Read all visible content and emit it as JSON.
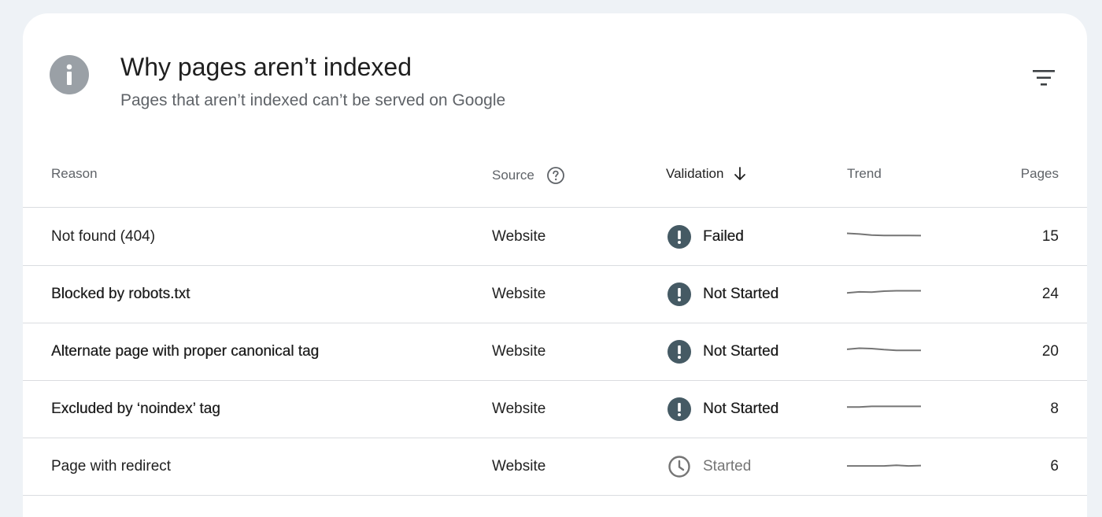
{
  "header": {
    "title": "Why pages aren’t indexed",
    "subtitle": "Pages that aren’t indexed can’t be served on Google",
    "icon": "info-icon",
    "filter_icon": "filter-icon"
  },
  "table": {
    "columns": {
      "reason": "Reason",
      "source": "Source",
      "validation": "Validation",
      "trend": "Trend",
      "pages": "Pages"
    },
    "sort_icon": "arrow-down-icon",
    "help_icon": "help-icon",
    "rows": [
      {
        "reason": "Not found (404)",
        "source": "Website",
        "validation": "Failed",
        "validation_icon": "exclamation-icon",
        "trend": [
          1,
          0.9,
          0.75,
          0.7,
          0.7,
          0.7,
          0.68
        ],
        "pages": "15"
      },
      {
        "reason": "Blocked by robots.txt",
        "source": "Website",
        "validation": "Not Started",
        "validation_icon": "exclamation-icon",
        "trend": [
          0.7,
          0.85,
          0.8,
          0.95,
          1,
          1,
          1
        ],
        "pages": "24"
      },
      {
        "reason": "Alternate page with proper canonical tag",
        "source": "Website",
        "validation": "Not Started",
        "validation_icon": "exclamation-icon",
        "trend": [
          0.85,
          1,
          0.95,
          0.8,
          0.7,
          0.7,
          0.7
        ],
        "pages": "20"
      },
      {
        "reason": "Excluded by ‘noindex’ tag",
        "source": "Website",
        "validation": "Not Started",
        "validation_icon": "exclamation-icon",
        "trend": [
          0.8,
          0.8,
          0.9,
          0.9,
          0.9,
          0.9,
          0.9
        ],
        "pages": "8"
      },
      {
        "reason": "Page with redirect",
        "source": "Website",
        "validation": "Started",
        "validation_icon": "clock-icon",
        "trend": [
          0.6,
          0.6,
          0.6,
          0.6,
          0.7,
          0.6,
          0.65
        ],
        "pages": "6"
      }
    ]
  },
  "colors": {
    "status_icon": "#455a64",
    "started_icon": "#757575",
    "trend_line": "#757575",
    "divider": "#dadce0"
  }
}
